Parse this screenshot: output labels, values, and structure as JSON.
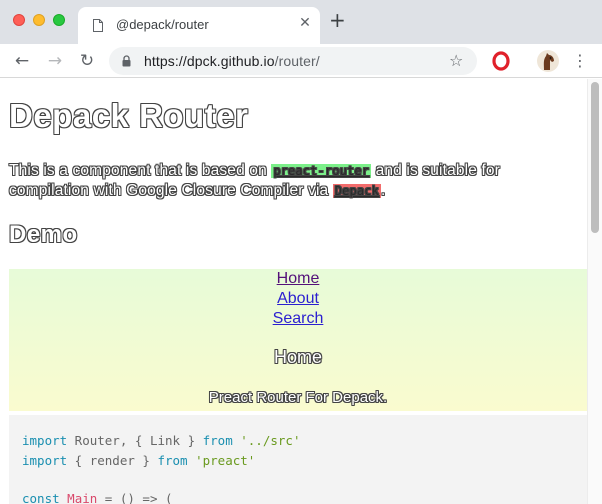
{
  "browser": {
    "tab_title": "@depack/router",
    "tab_close": "✕",
    "new_tab": "+",
    "url_host": "https://dpck.github.io",
    "url_path": "/router/",
    "colors": {
      "tabstrip": "#dee1e6",
      "close_dot": "#fe5f57",
      "minimize_dot": "#febc2e",
      "zoom_dot": "#28c840"
    }
  },
  "page": {
    "title": "Depack Router",
    "intro": {
      "before": "This is a component that is based on ",
      "lib1": "preact-router",
      "middle": " and is suitable for compilation with Google Closure Compiler via ",
      "lib2": "Depack",
      "after": "."
    },
    "demo_heading": "Demo",
    "demo": {
      "nav": [
        {
          "label": "Home",
          "active": true
        },
        {
          "label": "About",
          "active": false
        },
        {
          "label": "Search",
          "active": false
        }
      ],
      "page_title": "Home",
      "tagline": "Preact Router For Depack."
    },
    "code": {
      "line1": {
        "kw": "import",
        "a": " Router, { Link } ",
        "kw2": "from",
        "str": " '../src'"
      },
      "line2": {
        "kw": "import",
        "a": " { render } ",
        "kw2": "from",
        "str": " 'preact'"
      },
      "line3": {
        "kw": "const",
        "fn": " Main",
        "rest": " = () => ("
      }
    }
  }
}
